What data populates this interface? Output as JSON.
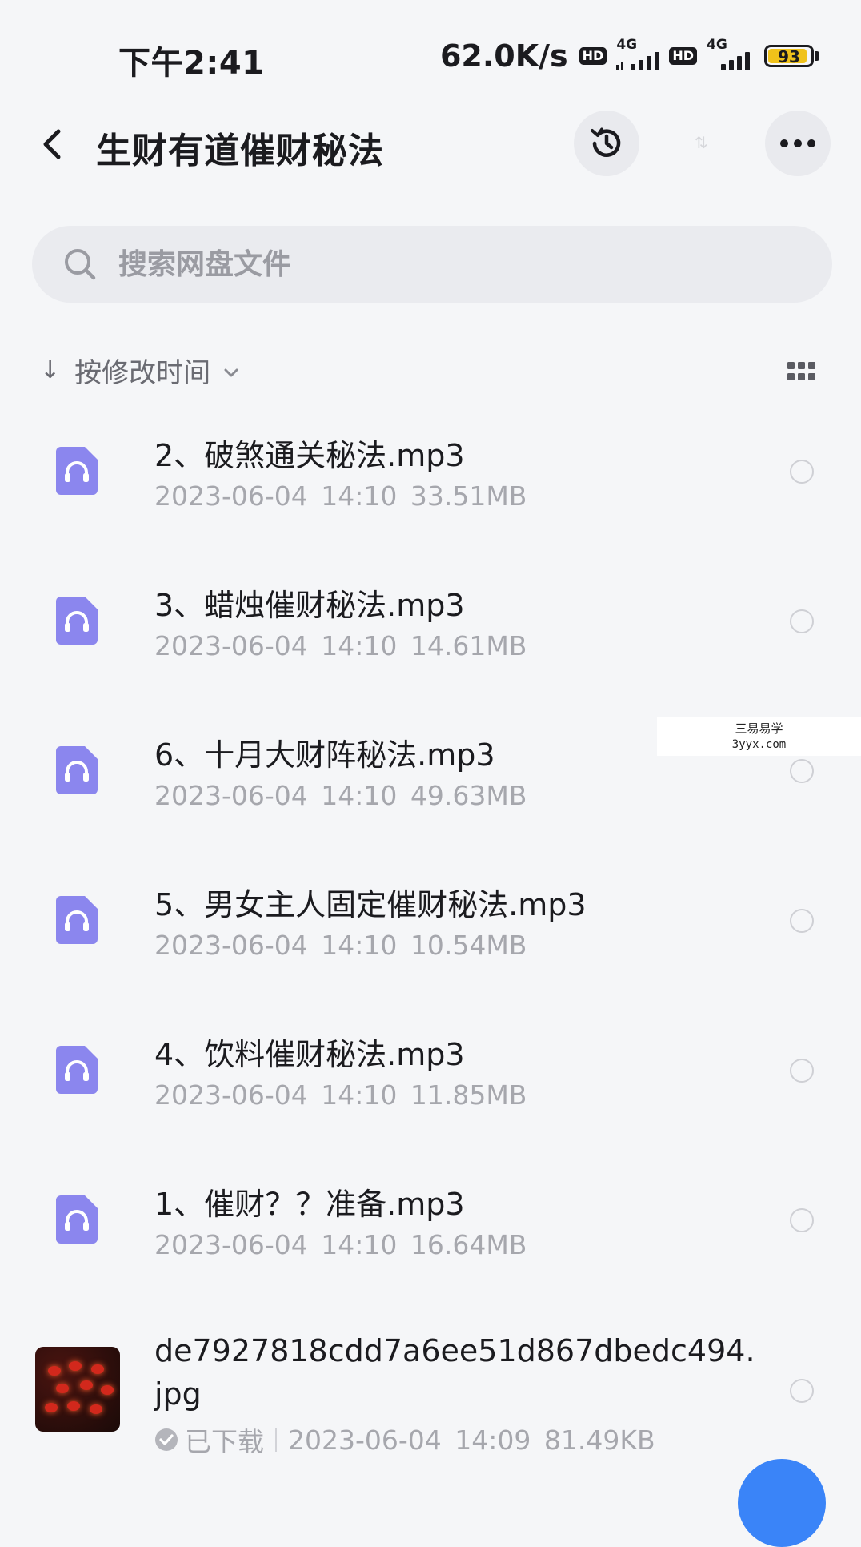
{
  "status_bar": {
    "time": "下午2:41",
    "net_speed": "62.0K/s",
    "hd_label": "HD",
    "network_type": "4G",
    "battery": "93",
    "battery_level": 0.93
  },
  "header": {
    "title": "生财有道催财秘法",
    "back_icon": "chevron-left-icon",
    "history_icon": "history-icon",
    "more_icon": "more-icon"
  },
  "search": {
    "placeholder": "搜索网盘文件"
  },
  "sort": {
    "label": "按修改时间",
    "arrow": "↓"
  },
  "files": [
    {
      "name": "2、破煞通关秘法.mp3",
      "meta": "2023-06-04  14:10  33.51MB"
    },
    {
      "name": "3、蜡烛催财秘法.mp3",
      "meta": "2023-06-04  14:10  14.61MB"
    },
    {
      "name": "6、十月大财阵秘法.mp3",
      "meta": "2023-06-04  14:10  49.63MB"
    },
    {
      "name": "5、男女主人固定催财秘法.mp3",
      "meta": "2023-06-04  14:10  10.54MB"
    },
    {
      "name": "4、饮料催财秘法.mp3",
      "meta": "2023-06-04  14:10  11.85MB"
    },
    {
      "name": "1、催财？？准备.mp3",
      "meta": "2023-06-04  14:10  16.64MB"
    }
  ],
  "image_file": {
    "name": "de7927818cdd7a6ee51d867dbedc494.jpg",
    "status": "已下载",
    "meta": "2023-06-04  14:09  81.49KB"
  },
  "watermark": {
    "line1": "三易易学",
    "line2": "3yyx.com"
  },
  "colors": {
    "audio_icon": "#8b86ee",
    "accent": "#3a84f8"
  }
}
